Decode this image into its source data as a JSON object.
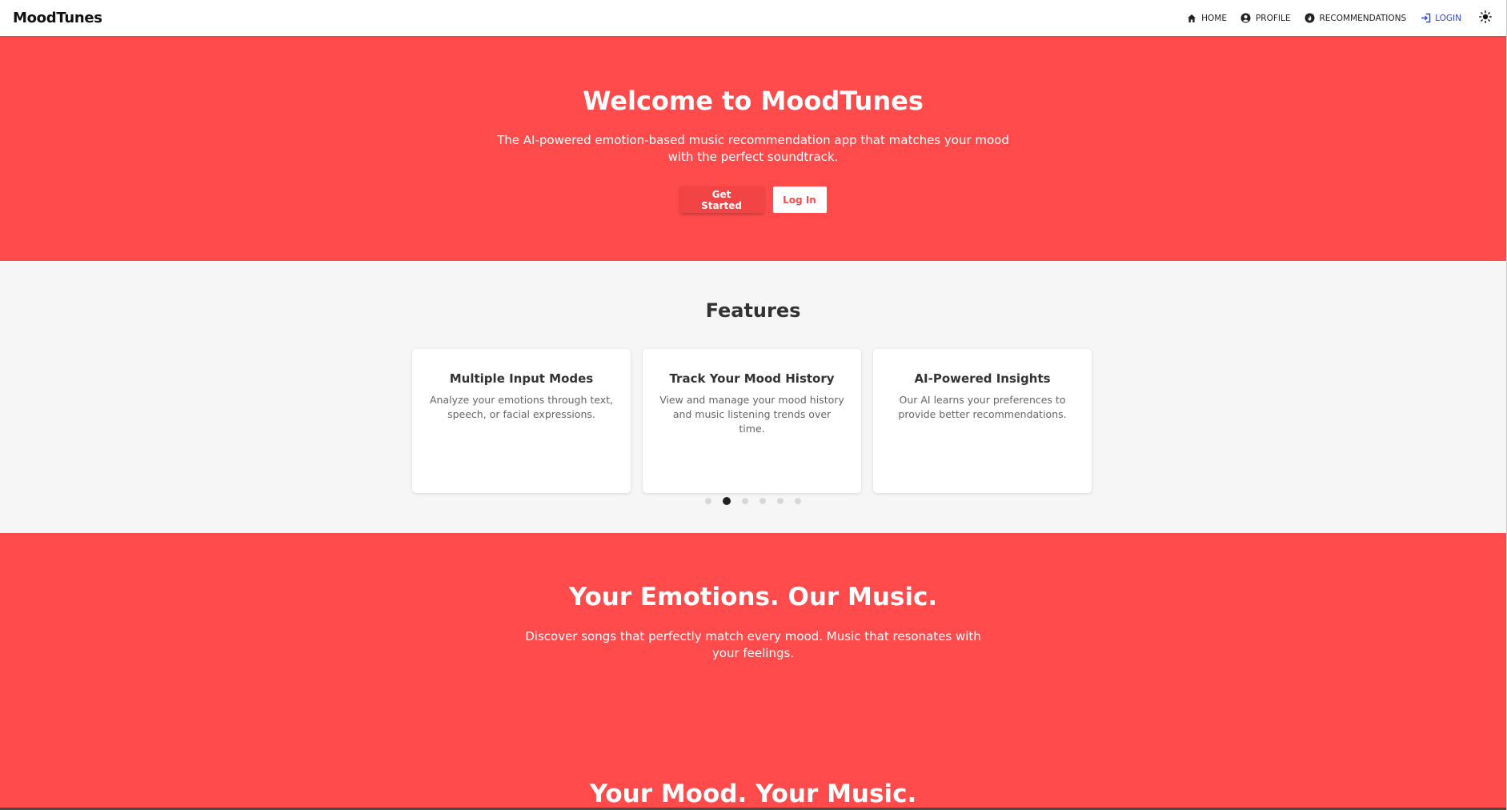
{
  "navbar": {
    "brand": "MoodTunes",
    "items": [
      {
        "label": "HOME",
        "icon": "home-icon"
      },
      {
        "label": "PROFILE",
        "icon": "user-circle-icon"
      },
      {
        "label": "RECOMMENDATIONS",
        "icon": "fire-icon"
      },
      {
        "label": "LOGIN",
        "icon": "login-icon"
      }
    ],
    "theme_icon": "sun-icon"
  },
  "hero": {
    "title": "Welcome to MoodTunes",
    "description": "The AI-powered emotion-based music recommendation app that matches your mood with the perfect soundtrack.",
    "primary_button": "Get Started",
    "secondary_button": "Log In"
  },
  "features": {
    "title": "Features",
    "cards": [
      {
        "title": "Multiple Input Modes",
        "description": "Analyze your emotions through text, speech, or facial expressions."
      },
      {
        "title": "Track Your Mood History",
        "description": "View and manage your mood history and music listening trends over time."
      },
      {
        "title": "AI-Powered Insights",
        "description": "Our AI learns your preferences to provide better recommendations."
      }
    ],
    "carousel": {
      "total": 6,
      "active_index": 1
    }
  },
  "section_emotions": {
    "title": "Your Emotions. Our Music.",
    "description": "Discover songs that perfectly match every mood. Music that resonates with your feelings."
  },
  "section_mood": {
    "title": "Your Mood. Your Music."
  },
  "colors": {
    "brand": "#ff4b4c",
    "primary_button": "#f24445",
    "login_link": "#3346d6",
    "features_bg": "#f6f6f6"
  }
}
